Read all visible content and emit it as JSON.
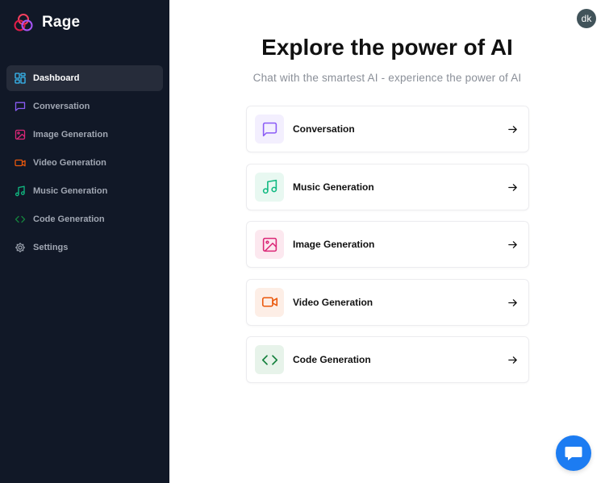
{
  "brand": {
    "name": "Rage",
    "logo_icon": "rings-logo"
  },
  "sidebar": {
    "items": [
      {
        "label": "Dashboard",
        "icon": "dashboard-icon",
        "color": "#38bdf8",
        "active": true
      },
      {
        "label": "Conversation",
        "icon": "message-square-icon",
        "color": "#8b5cf6",
        "active": false
      },
      {
        "label": "Image Generation",
        "icon": "image-icon",
        "color": "#db2777",
        "active": false
      },
      {
        "label": "Video Generation",
        "icon": "video-icon",
        "color": "#ea580c",
        "active": false
      },
      {
        "label": "Music Generation",
        "icon": "music-icon",
        "color": "#10b981",
        "active": false
      },
      {
        "label": "Code Generation",
        "icon": "code-icon",
        "color": "#15803d",
        "active": false
      },
      {
        "label": "Settings",
        "icon": "gear-icon",
        "color": "#9ca3af",
        "active": false
      }
    ]
  },
  "user": {
    "avatar_initials": "dk"
  },
  "main": {
    "title": "Explore the power of AI",
    "subtitle": "Chat with the smartest AI - experience the power of AI",
    "tools": [
      {
        "label": "Conversation",
        "icon": "message-square-icon",
        "color": "#8b5cf6",
        "bg": "#f3effe"
      },
      {
        "label": "Music Generation",
        "icon": "music-icon",
        "color": "#10b981",
        "bg": "#e8f8f1"
      },
      {
        "label": "Image Generation",
        "icon": "image-icon",
        "color": "#db2777",
        "bg": "#fce8ef"
      },
      {
        "label": "Video Generation",
        "icon": "video-icon",
        "color": "#ea580c",
        "bg": "#fdeee6"
      },
      {
        "label": "Code Generation",
        "icon": "code-icon",
        "color": "#15803d",
        "bg": "#e7f3ea"
      }
    ]
  },
  "support": {
    "icon": "chat-bubble-icon",
    "color": "#1c7cf2"
  }
}
